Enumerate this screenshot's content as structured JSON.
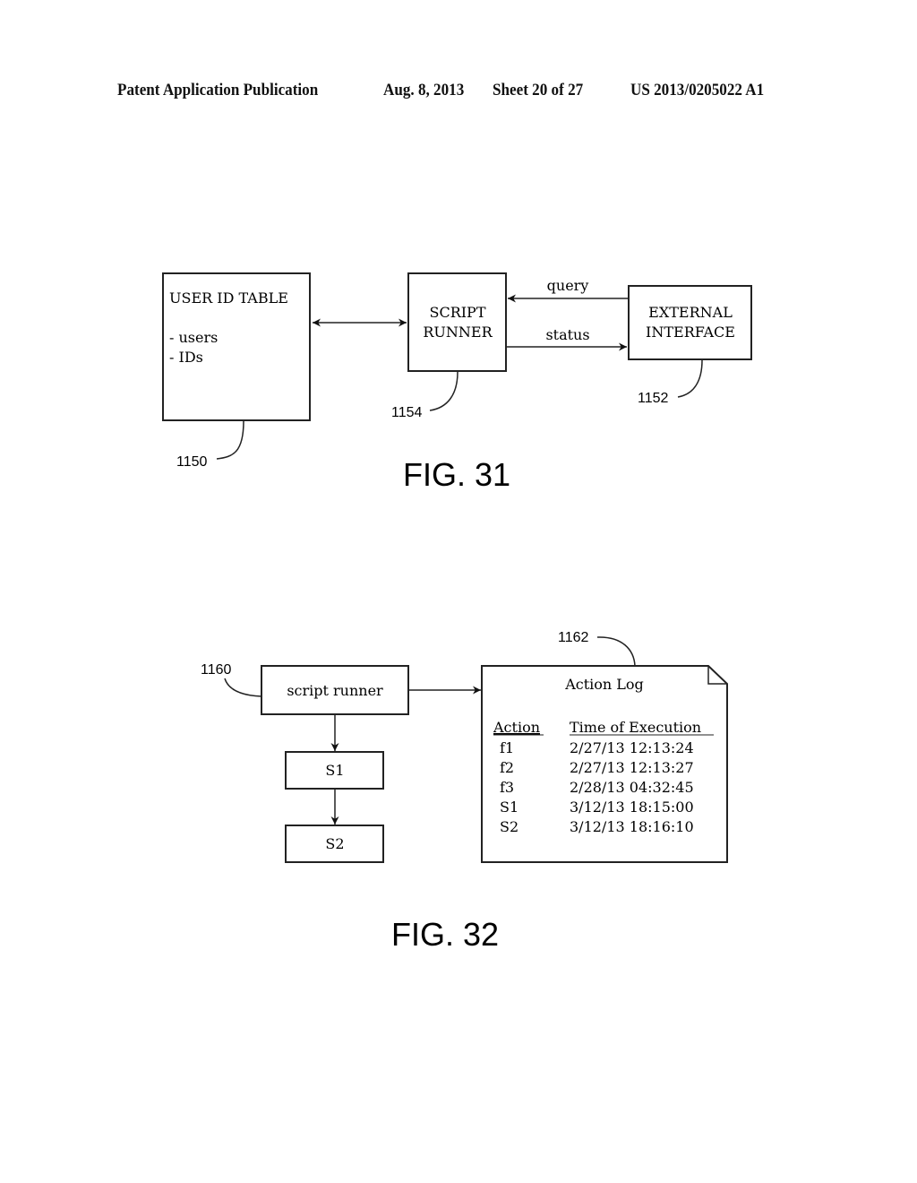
{
  "header": {
    "publication": "Patent Application Publication",
    "date": "Aug. 8, 2013",
    "sheet": "Sheet 20 of 27",
    "number": "US 2013/0205022 A1"
  },
  "fig31": {
    "caption": "FIG. 31",
    "user_id_table": {
      "title": "USER ID TABLE",
      "items": [
        "- users",
        "- IDs"
      ],
      "ref": "1150"
    },
    "script_runner": {
      "line1": "SCRIPT",
      "line2": "RUNNER",
      "ref": "1154"
    },
    "external_interface": {
      "line1": "EXTERNAL",
      "line2": "INTERFACE",
      "ref": "1152"
    },
    "arrows": {
      "query": "query",
      "status": "status"
    }
  },
  "fig32": {
    "caption": "FIG. 32",
    "script_runner": {
      "label": "script runner",
      "ref": "1160"
    },
    "s1": "S1",
    "s2": "S2",
    "action_log": {
      "ref": "1162",
      "title": "Action Log",
      "col_action": "Action",
      "col_time": "Time of Execution",
      "rows": [
        {
          "action": "f1",
          "time": "2/27/13 12:13:24"
        },
        {
          "action": "f2",
          "time": "2/27/13 12:13:27"
        },
        {
          "action": "f3",
          "time": "2/28/13 04:32:45"
        },
        {
          "action": "S1",
          "time": "3/12/13 18:15:00"
        },
        {
          "action": "S2",
          "time": "3/12/13 18:16:10"
        }
      ]
    }
  }
}
